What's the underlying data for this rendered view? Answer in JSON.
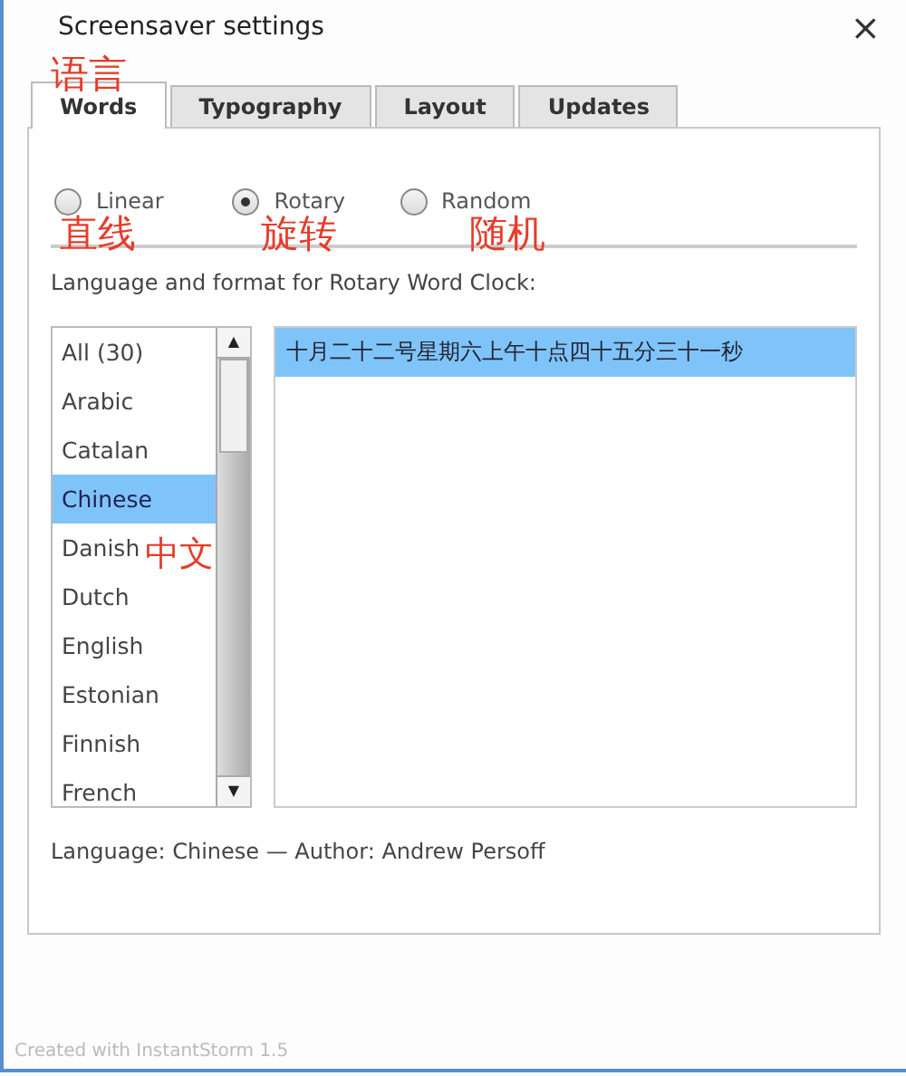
{
  "window": {
    "title": "Screensaver settings",
    "close": "×"
  },
  "tabs": [
    {
      "label": "Words",
      "selected": true
    },
    {
      "label": "Typography",
      "selected": false
    },
    {
      "label": "Layout",
      "selected": false
    },
    {
      "label": "Updates",
      "selected": false
    }
  ],
  "modes": [
    {
      "label": "Linear",
      "selected": false
    },
    {
      "label": "Rotary",
      "selected": true
    },
    {
      "label": "Random",
      "selected": false
    }
  ],
  "format_label": "Language and format for Rotary Word Clock:",
  "languages": [
    {
      "label": "All (30)",
      "selected": false
    },
    {
      "label": "Arabic",
      "selected": false
    },
    {
      "label": "Catalan",
      "selected": false
    },
    {
      "label": "Chinese",
      "selected": true
    },
    {
      "label": "Danish",
      "selected": false
    },
    {
      "label": "Dutch",
      "selected": false
    },
    {
      "label": "English",
      "selected": false
    },
    {
      "label": "Estonian",
      "selected": false
    },
    {
      "label": "Finnish",
      "selected": false
    },
    {
      "label": "French",
      "selected": false
    }
  ],
  "scroll_up": "▲",
  "scroll_down": "▼",
  "formats": [
    {
      "label": "十月二十二号星期六上午十点四十五分三十一秒",
      "selected": true
    }
  ],
  "footer": "Language: Chinese — Author: Andrew Persoff",
  "credit": "Created with InstantStorm 1.5",
  "annotations": [
    {
      "text": "语言"
    },
    {
      "text": "直线"
    },
    {
      "text": "旋转"
    },
    {
      "text": "随机"
    },
    {
      "text": "中文"
    }
  ]
}
